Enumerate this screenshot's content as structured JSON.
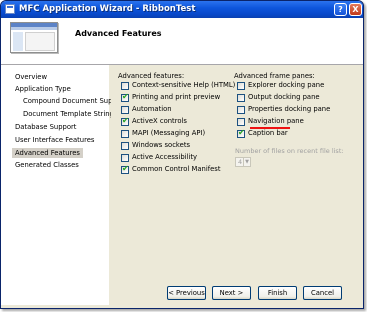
{
  "window": {
    "title": "MFC Application Wizard - RibbonTest"
  },
  "title_buttons": {
    "help": "?",
    "close": "X"
  },
  "header": {
    "page_title": "Advanced Features"
  },
  "nav": {
    "items": [
      "Overview",
      "Application Type",
      "Compound Document Support",
      "Document Template Strings",
      "Database Support",
      "User Interface Features",
      "Advanced Features",
      "Generated Classes"
    ],
    "selected": "Advanced Features"
  },
  "advanced_features": {
    "label": "Advanced features:",
    "options": [
      {
        "label": "Context-sensitive Help (HTML)",
        "checked": false
      },
      {
        "label": "Printing and print preview",
        "checked": true
      },
      {
        "label": "Automation",
        "checked": false
      },
      {
        "label": "ActiveX controls",
        "checked": true
      },
      {
        "label": "MAPI (Messaging API)",
        "checked": false
      },
      {
        "label": "Windows sockets",
        "checked": false
      },
      {
        "label": "Active Accessibility",
        "checked": false
      },
      {
        "label": "Common Control Manifest",
        "checked": true
      }
    ]
  },
  "frame_panes": {
    "label": "Advanced frame panes:",
    "options": [
      {
        "label": "Explorer docking pane",
        "checked": false
      },
      {
        "label": "Output docking pane",
        "checked": false
      },
      {
        "label": "Properties docking pane",
        "checked": false
      },
      {
        "label": "Navigation pane",
        "checked": false
      },
      {
        "label": "Caption bar",
        "checked": true
      }
    ]
  },
  "recent_files": {
    "label": "Number of files on recent file list:",
    "value": "4"
  },
  "buttons": {
    "previous": "< Previous",
    "next": "Next >",
    "finish": "Finish",
    "cancel": "Cancel"
  },
  "colors": {
    "title_bar": "#0848c9",
    "dialog_bg": "#ece9d8",
    "highlight_underline": "#ee1111"
  }
}
